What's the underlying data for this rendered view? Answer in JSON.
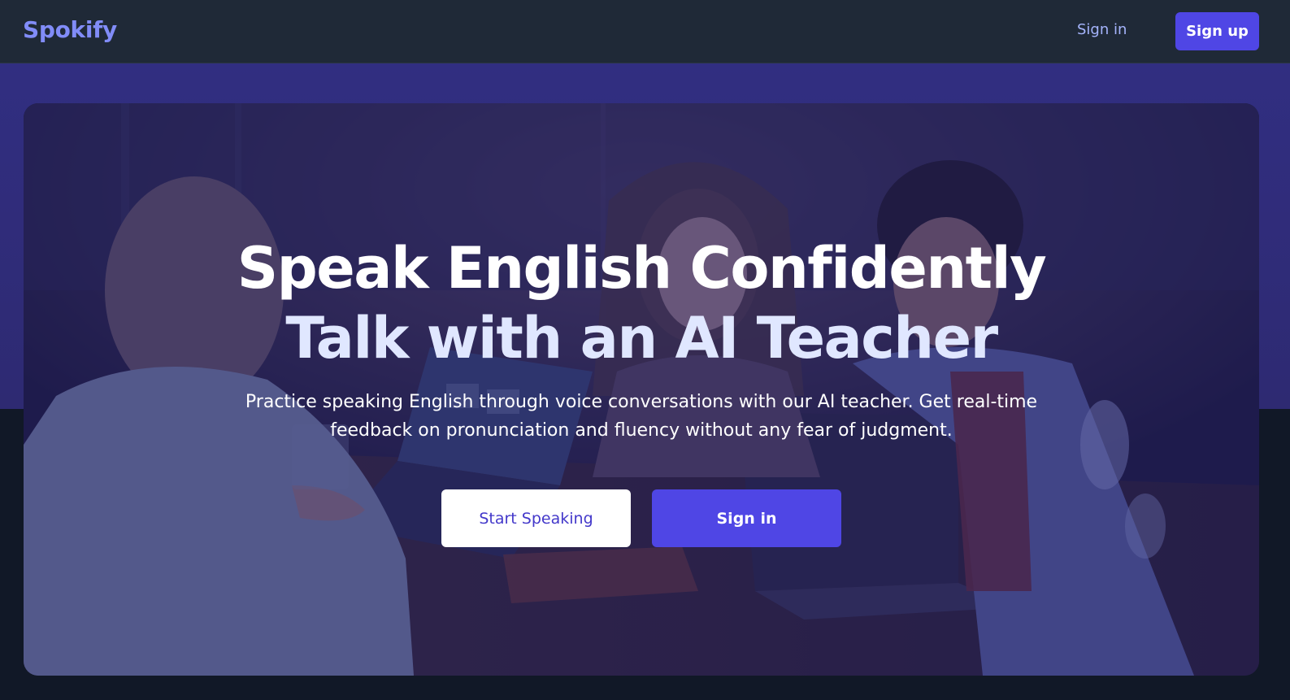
{
  "header": {
    "brand": "Spokify",
    "sign_in_label": "Sign in",
    "sign_up_label": "Sign up"
  },
  "hero": {
    "headline_line1": "Speak English Confidently",
    "headline_line2": "Talk with an AI Teacher",
    "subtitle": "Practice speaking English through voice conversations with our AI teacher. Get real-time feedback on pronunciation and fluency without any fear of judgment.",
    "primary_cta": "Start Speaking",
    "secondary_cta": "Sign in"
  },
  "colors": {
    "brand": "#818cf8",
    "accent": "#4f46e5",
    "header_bg": "#1f2937",
    "band_bg": "#312e81",
    "page_bg": "#111827",
    "headline": "#ffffff",
    "headline_secondary": "#e0e7ff",
    "cta_text": "#4338ca"
  }
}
